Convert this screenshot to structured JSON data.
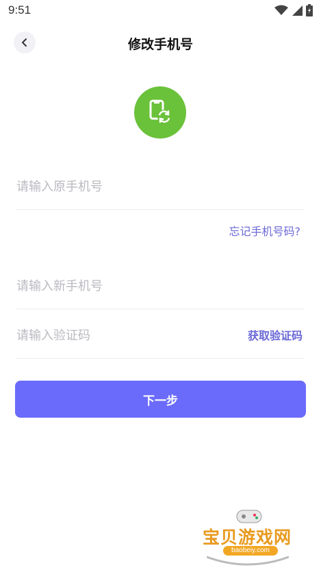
{
  "status_bar": {
    "time": "9:51"
  },
  "header": {
    "title": "修改手机号"
  },
  "form": {
    "old_phone": {
      "placeholder": "请输入原手机号",
      "value": ""
    },
    "forgot_link": "忘记手机号码?",
    "new_phone": {
      "placeholder": "请输入新手机号",
      "value": ""
    },
    "code": {
      "placeholder": "请输入验证码",
      "value": ""
    },
    "get_code_label": "获取验证码",
    "next_label": "下一步"
  },
  "watermark": {
    "text": "宝贝游戏网",
    "url": "baobeiy.com"
  },
  "colors": {
    "accent": "#6b6bfb",
    "link": "#6a68d6",
    "logo_green": "#6ac13a"
  },
  "icons": {
    "back": "chevron-left-icon",
    "logo": "phone-sync-icon"
  }
}
